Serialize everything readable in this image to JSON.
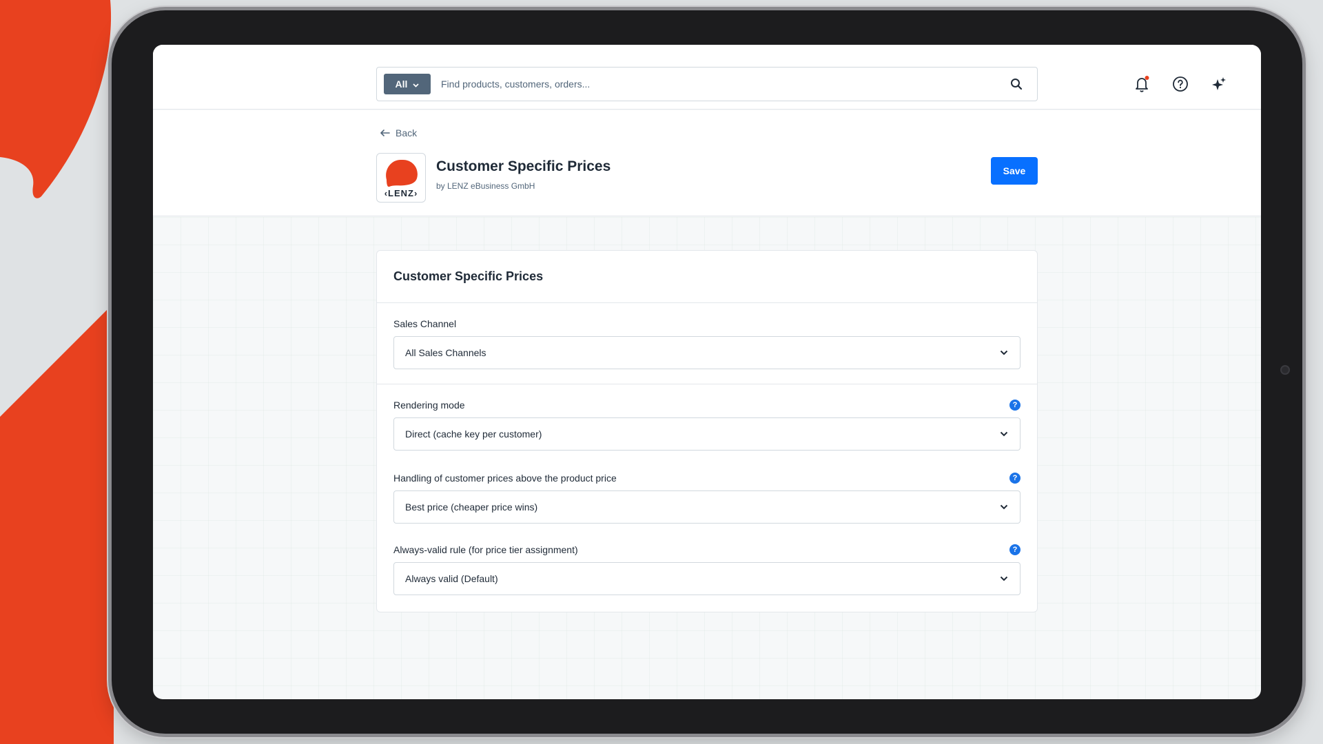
{
  "topbar": {
    "search_scope": "All",
    "search_placeholder": "Find products, customers, orders..."
  },
  "header": {
    "back_label": "Back",
    "app_title": "Customer Specific Prices",
    "app_vendor": "by LENZ eBusiness GmbH",
    "logo_text": "‹LENZ›",
    "save_label": "Save"
  },
  "card": {
    "title": "Customer Specific Prices",
    "fields": [
      {
        "label": "Sales Channel",
        "value": "All Sales Channels",
        "has_help": false
      },
      {
        "label": "Rendering mode",
        "value": "Direct (cache key per customer)",
        "has_help": true
      },
      {
        "label": "Handling of customer prices above the product price",
        "value": "Best price (cheaper price wins)",
        "has_help": true
      },
      {
        "label": "Always-valid rule (for price tier assignment)",
        "value": "Always valid (Default)",
        "has_help": true
      }
    ]
  },
  "colors": {
    "brand_accent": "#0870ff",
    "logo_orange": "#e8411f",
    "help_blue": "#1a73e8",
    "scope_badge": "#52667a",
    "notification_dot": "#e8411f"
  },
  "icons": {
    "search": "search-icon",
    "notifications": "bell-icon",
    "help": "question-circle-icon",
    "ai": "sparkles-icon",
    "back": "arrow-left-icon",
    "dropdown": "chevron-down-icon"
  }
}
